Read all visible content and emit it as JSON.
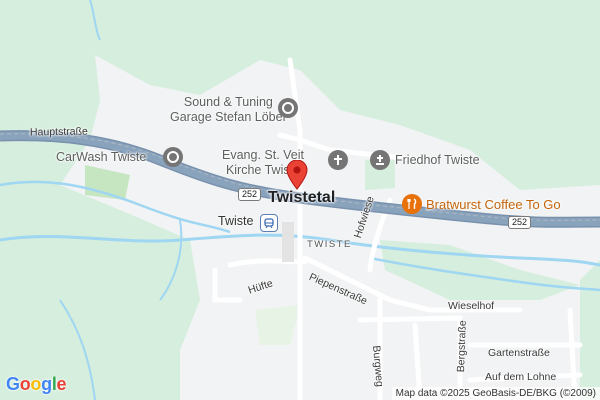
{
  "map": {
    "town_name": "Twistetal",
    "place_name": "TWISTE",
    "pois": [
      {
        "line1": "Sound & Tuning",
        "line2": "Garage Stefan Löber",
        "icon": "pin-dot-icon"
      },
      {
        "line1": "CarWash Twiste",
        "icon": "pin-dot-icon"
      },
      {
        "line1": "Evang. St. Veit",
        "line2": "Kirche Twiste",
        "icon": "church-cross-icon"
      },
      {
        "line1": "Friedhof Twiste",
        "icon": "cemetery-icon"
      },
      {
        "line1": "Bratwurst Coffee To Go",
        "icon": "restaurant-fork-knife-icon",
        "color": "#e8710a"
      },
      {
        "line1": "Twiste",
        "icon": "train-station-icon"
      }
    ],
    "streets": {
      "hauptstrasse": "Hauptstraße",
      "hofwiese": "Hofwiese",
      "huefte": "Hüfte",
      "piepenstrasse": "Piepenstraße",
      "wieselhof": "Wieselhof",
      "burgweg": "Burgweg",
      "bergstrasse": "Bergstraße",
      "gartenstrasse": "Gartenstraße",
      "auf_dem_lohne": "Auf dem Lohne"
    },
    "road_shields": [
      "252",
      "252"
    ],
    "attribution": "Map data ©2025 GeoBasis-DE/BKG (©2009)",
    "logo": "Google",
    "colors": {
      "background_green": "#d5eedd",
      "settlement": "#f1f3f4",
      "water": "#9fd6f2",
      "highway": "#8aa3bd",
      "poi_accent": "#e8710a",
      "marker": "#ea4335"
    }
  }
}
